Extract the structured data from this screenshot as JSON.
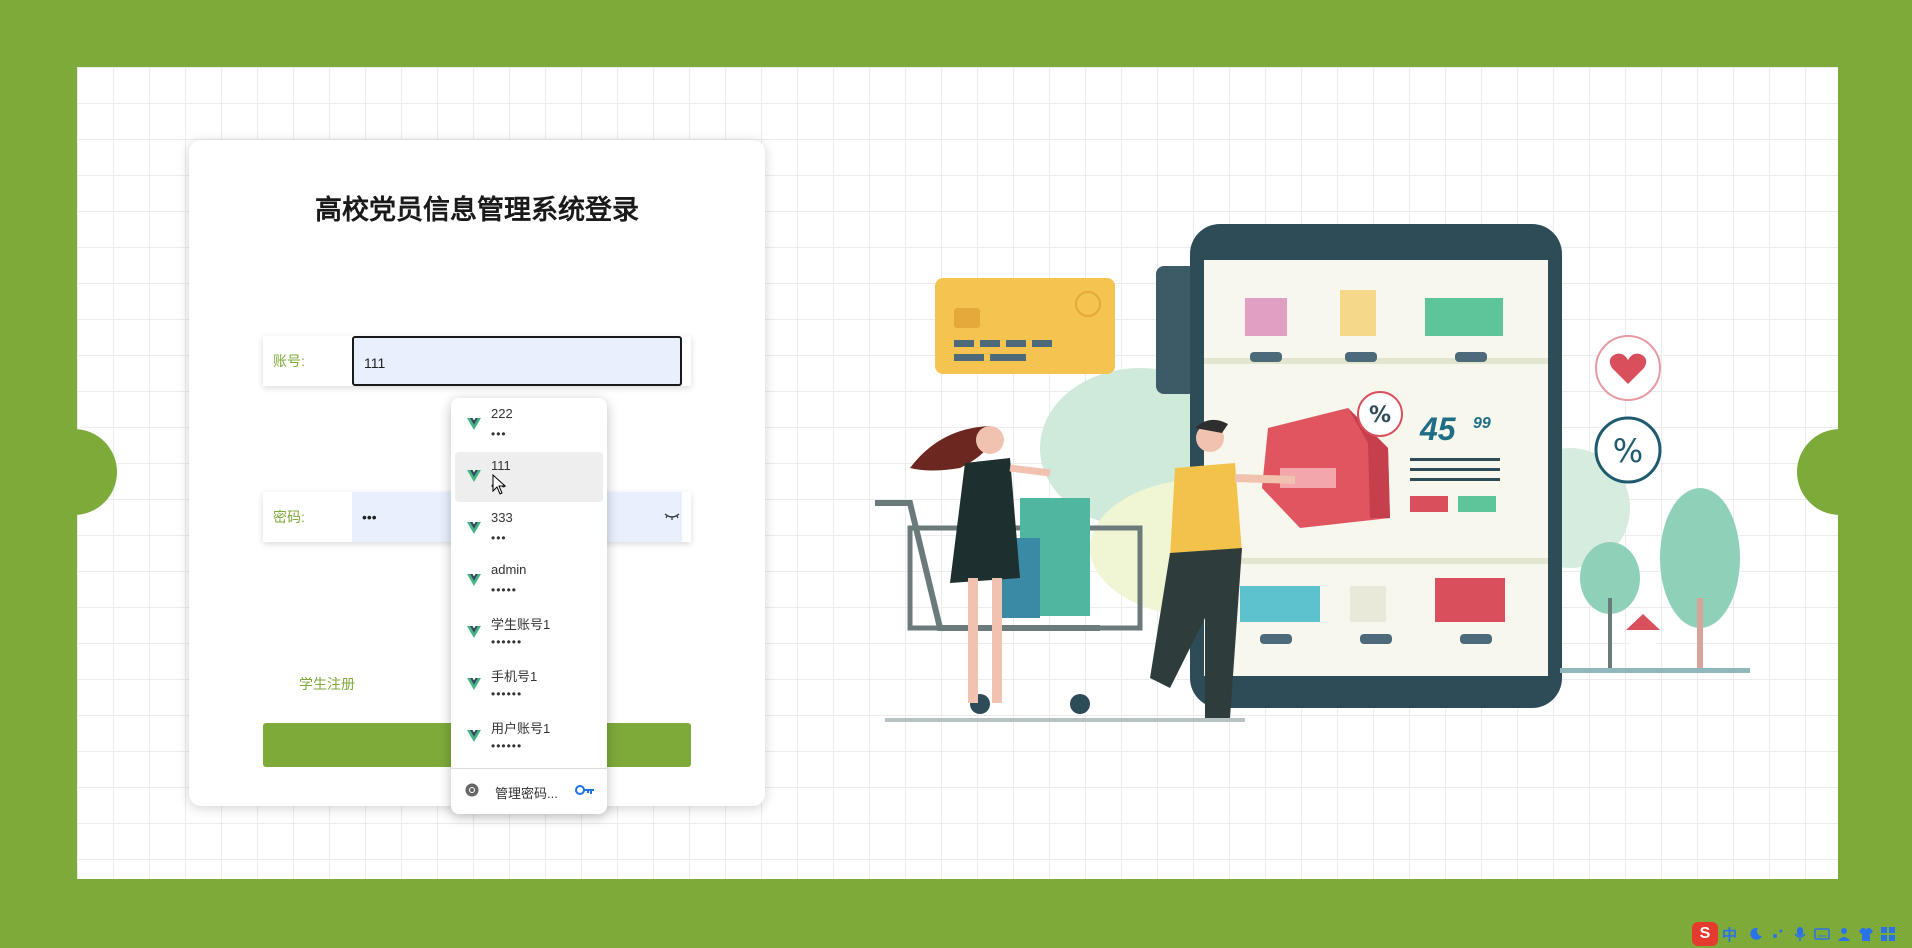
{
  "login": {
    "title": "高校党员信息管理系统登录",
    "account_label": "账号:",
    "account_value": "111",
    "password_label": "密码:",
    "password_value": "•••",
    "register_link": "学生注册"
  },
  "autocomplete": {
    "items": [
      {
        "username": "222",
        "password": "•••"
      },
      {
        "username": "111",
        "password": "•••"
      },
      {
        "username": "333",
        "password": "•••"
      },
      {
        "username": "admin",
        "password": "•••••"
      },
      {
        "username": "学生账号1",
        "password": "••••••"
      },
      {
        "username": "手机号1",
        "password": "••••••"
      },
      {
        "username": "用户账号1",
        "password": "••••••"
      }
    ],
    "manage_label": "管理密码..."
  },
  "illustration": {
    "price_main": "45",
    "price_cents": "99",
    "percent": "%"
  },
  "taskbar": {
    "ime_logo": "S",
    "ime_lang": "中"
  },
  "colors": {
    "brand_green": "#7eaa3a",
    "input_fill": "#e8f0fe"
  }
}
